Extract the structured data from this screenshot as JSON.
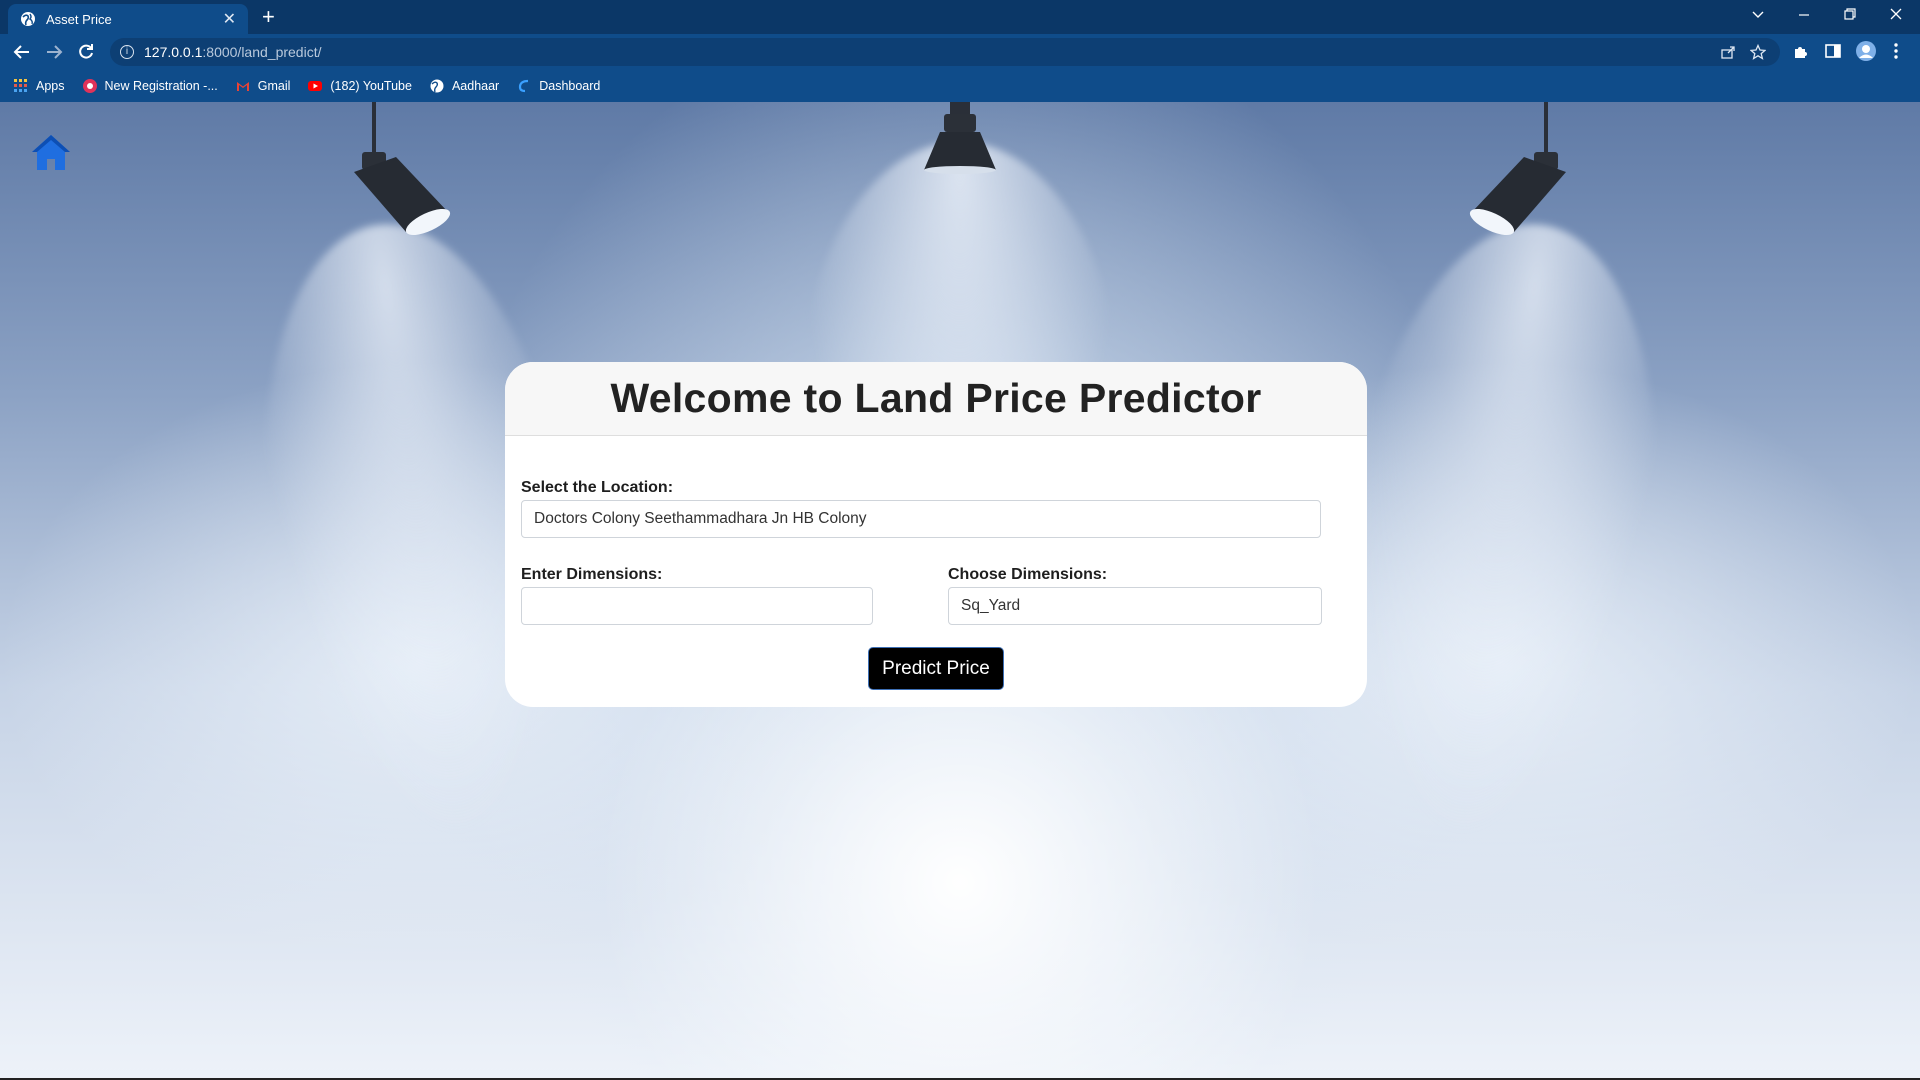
{
  "browser": {
    "tab_title": "Asset Price",
    "close_glyph": "✕",
    "new_tab_glyph": "+",
    "url_host": "127.0.0.1",
    "url_rest": ":8000/land_predict/",
    "bookmarks": [
      {
        "label": "Apps",
        "icon": "apps-grid-icon"
      },
      {
        "label": "New Registration -...",
        "icon": "registration-icon"
      },
      {
        "label": "Gmail",
        "icon": "gmail-icon"
      },
      {
        "label": "(182) YouTube",
        "icon": "youtube-icon"
      },
      {
        "label": "Aadhaar",
        "icon": "globe-icon"
      },
      {
        "label": "Dashboard",
        "icon": "dashboard-icon"
      }
    ]
  },
  "page": {
    "title": "Welcome to Land Price Predictor",
    "location_label": "Select the Location:",
    "location_value": "Doctors Colony Seethammadhara Jn HB Colony",
    "dimensions_label": "Enter Dimensions:",
    "dimensions_value": "",
    "unit_label": "Choose Dimensions:",
    "unit_value": "Sq_Yard",
    "submit_label": "Predict Price"
  },
  "colors": {
    "chrome_dark": "#0b3767",
    "chrome": "#0f4c8a",
    "home_icon": "#1f6ee0",
    "button": "#000000"
  }
}
